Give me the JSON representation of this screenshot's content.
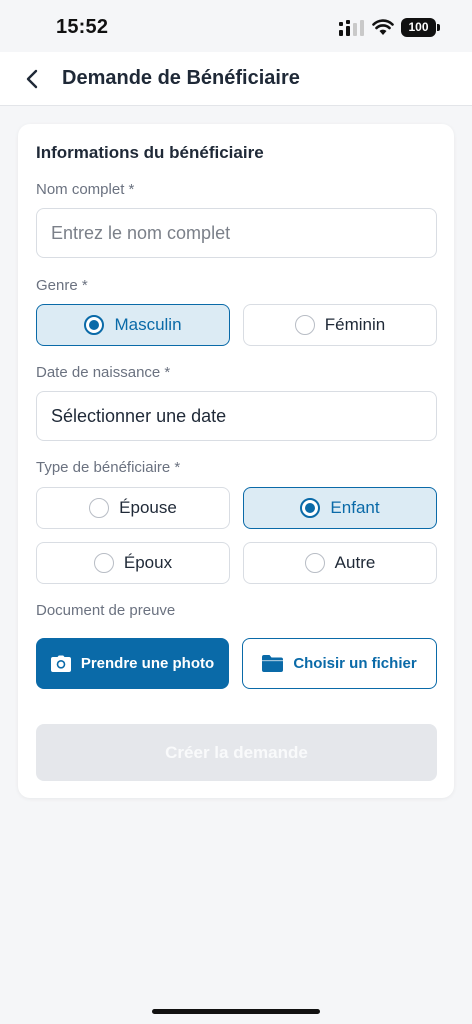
{
  "status_bar": {
    "time": "15:52",
    "battery": "100"
  },
  "header": {
    "title": "Demande de Bénéficiaire",
    "back_icon": "chevron-left-icon"
  },
  "form": {
    "section_title": "Informations du bénéficiaire",
    "name": {
      "label": "Nom complet *",
      "placeholder": "Entrez le nom complet"
    },
    "gender": {
      "label": "Genre *",
      "options": [
        "Masculin",
        "Féminin"
      ],
      "selected": "Masculin"
    },
    "birth_date": {
      "label": "Date de naissance *",
      "value": "Sélectionner une date"
    },
    "beneficiary_type": {
      "label": "Type de bénéficiaire *",
      "options": [
        "Épouse",
        "Enfant",
        "Époux",
        "Autre"
      ],
      "selected": "Enfant"
    },
    "document": {
      "label": "Document de preuve",
      "take_photo": "Prendre une photo",
      "choose_file": "Choisir un fichier"
    },
    "submit": "Créer la demande"
  },
  "colors": {
    "accent": "#0a6aa8",
    "selected_bg": "#dcebf4",
    "disabled_bg": "#e5e7eb"
  }
}
